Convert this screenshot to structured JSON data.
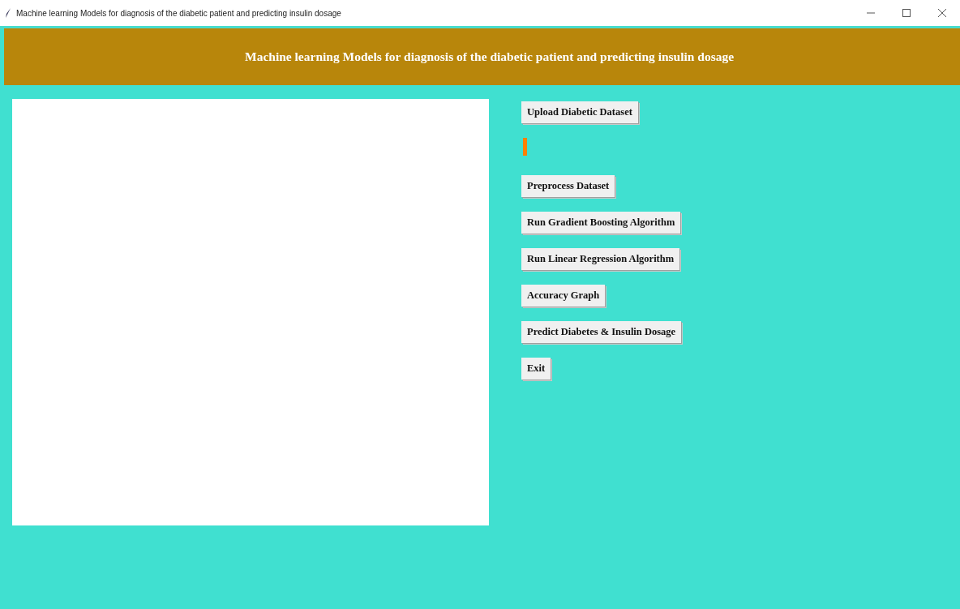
{
  "window": {
    "title": "Machine learning Models for diagnosis of the diabetic patient and predicting insulin dosage"
  },
  "header": {
    "title": "Machine learning Models for diagnosis of the diabetic patient and predicting insulin dosage"
  },
  "buttons": [
    {
      "label": "Upload Diabetic Dataset",
      "kind": "button"
    },
    {
      "kind": "status"
    },
    {
      "label": "Preprocess Dataset",
      "kind": "button"
    },
    {
      "label": "Run Gradient Boosting Algorithm",
      "kind": "button"
    },
    {
      "label": "Run Linear Regression Algorithm",
      "kind": "button"
    },
    {
      "label": "Accuracy Graph",
      "kind": "button"
    },
    {
      "label": "Predict Diabetes & Insulin Dosage",
      "kind": "button"
    },
    {
      "label": "Exit",
      "kind": "button"
    }
  ]
}
